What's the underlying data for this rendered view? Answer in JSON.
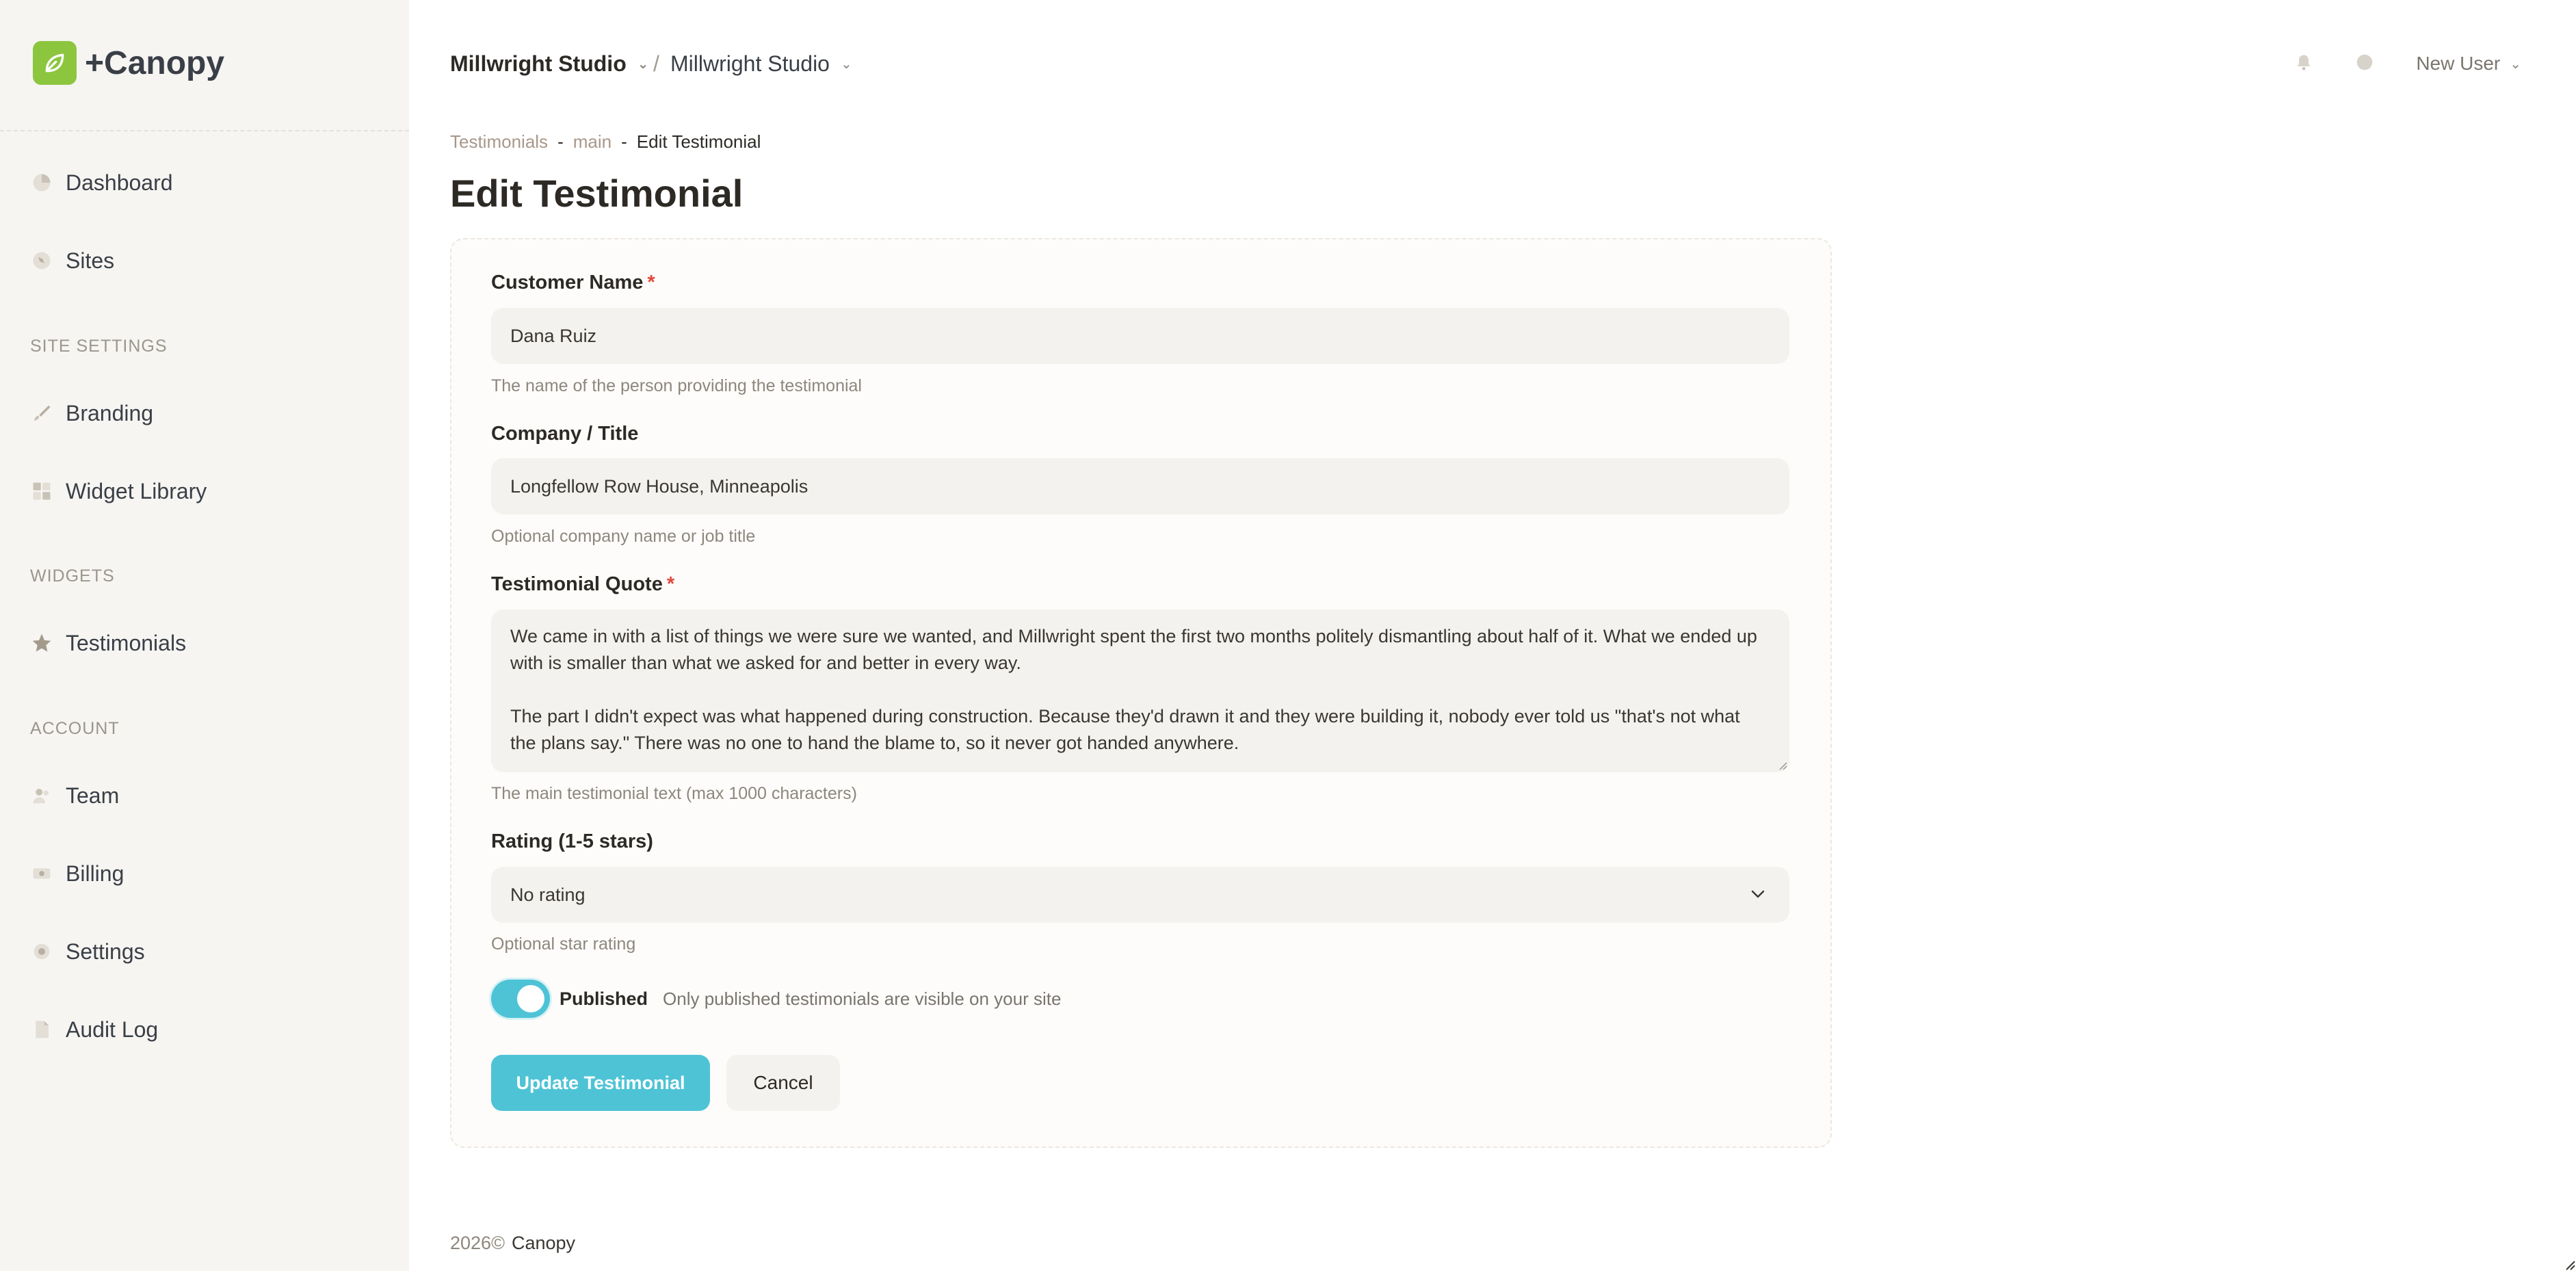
{
  "app": {
    "logo_text": "+Canopy",
    "brand_color": "#8cc63f",
    "accent_color": "#4ec3d6"
  },
  "sidebar": {
    "items_top": [
      {
        "label": "Dashboard",
        "icon": "pie-chart-icon"
      },
      {
        "label": "Sites",
        "icon": "globe-icon"
      }
    ],
    "site_settings_label": "SITE SETTINGS",
    "site_settings_items": [
      {
        "label": "Branding",
        "icon": "brush-icon"
      },
      {
        "label": "Widget Library",
        "icon": "grid-icon"
      }
    ],
    "widgets_label": "WIDGETS",
    "widgets_items": [
      {
        "label": "Testimonials",
        "icon": "star-icon"
      }
    ],
    "account_label": "ACCOUNT",
    "account_items": [
      {
        "label": "Team",
        "icon": "users-icon"
      },
      {
        "label": "Billing",
        "icon": "banknote-icon"
      },
      {
        "label": "Settings",
        "icon": "gear-icon"
      },
      {
        "label": "Audit Log",
        "icon": "document-icon"
      }
    ]
  },
  "topbar": {
    "org": "Millwright Studio",
    "separator": "/",
    "site": "Millwright Studio",
    "user": "New User"
  },
  "breadcrumb": {
    "items": [
      "Testimonials",
      "main",
      "Edit Testimonial"
    ],
    "separator": "-"
  },
  "page": {
    "title": "Edit Testimonial"
  },
  "form": {
    "customer_name": {
      "label": "Customer Name",
      "required_mark": "*",
      "value": "Dana Ruiz",
      "hint": "The name of the person providing the testimonial"
    },
    "company": {
      "label": "Company / Title",
      "value": "Longfellow Row House, Minneapolis",
      "hint": "Optional company name or job title"
    },
    "quote": {
      "label": "Testimonial Quote",
      "required_mark": "*",
      "value": "We came in with a list of things we were sure we wanted, and Millwright spent the first two months politely dismantling about half of it. What we ended up with is smaller than what we asked for and better in every way.\n\nThe part I didn't expect was what happened during construction. Because they'd drawn it and they were building it, nobody ever told us \"that's not what the plans say.\" There was no one to hand the blame to, so it never got handed anywhere.",
      "hint": "The main testimonial text (max 1000 characters)"
    },
    "rating": {
      "label": "Rating (1-5 stars)",
      "value": "No rating",
      "hint": "Optional star rating"
    },
    "published": {
      "label": "Published",
      "checked": true,
      "description": "Only published testimonials are visible on your site"
    },
    "submit_label": "Update Testimonial",
    "cancel_label": "Cancel"
  },
  "footer": {
    "year": "2026©",
    "brand": "Canopy"
  }
}
